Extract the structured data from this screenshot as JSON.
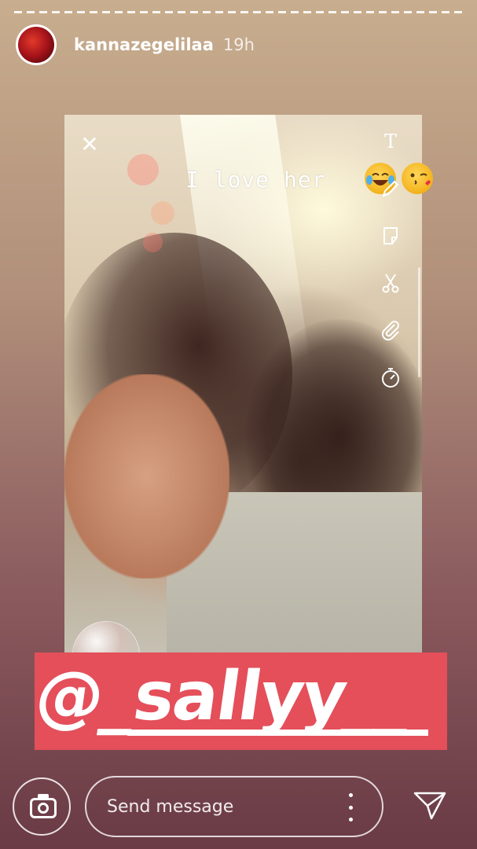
{
  "story": {
    "username": "kannazegelilaa",
    "time": "19h",
    "caption": "I love her",
    "emojis": [
      "face-with-tears-of-joy",
      "face-blowing-a-kiss"
    ],
    "mention": "@_sallyy__"
  },
  "tools": {
    "icons": [
      "text-icon",
      "pen-icon",
      "sticker-icon",
      "scissors-icon",
      "paperclip-icon",
      "timer-icon"
    ],
    "text_glyph": "T",
    "close_glyph": "✕"
  },
  "footer": {
    "message_placeholder": "Send message"
  },
  "colors": {
    "mention_bg": "#e44f5a",
    "text": "#ffffff"
  }
}
